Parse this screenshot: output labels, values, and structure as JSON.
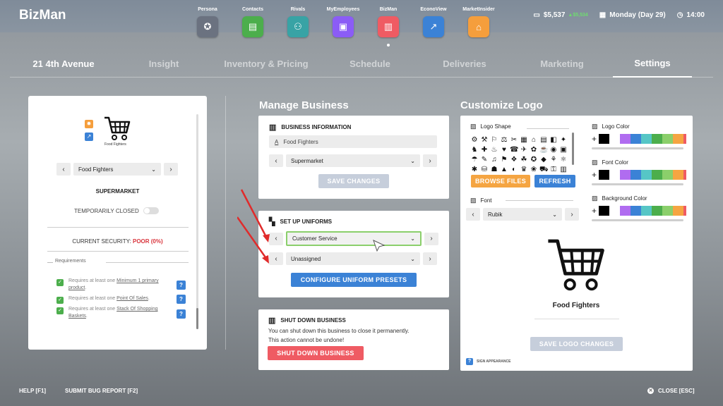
{
  "brand": "BizMan",
  "apps": [
    {
      "label": "Persona",
      "icon": "star-badge-icon",
      "color": "#6b7280",
      "glyph": "✪"
    },
    {
      "label": "Contacts",
      "icon": "chat-icon",
      "color": "#4cae4c",
      "glyph": "▤"
    },
    {
      "label": "Rivals",
      "icon": "group-icon",
      "color": "#38a3a5",
      "glyph": "⚇"
    },
    {
      "label": "MyEmployees",
      "icon": "id-badge-icon",
      "color": "#8b5cf6",
      "glyph": "▣"
    },
    {
      "label": "BizMan",
      "icon": "store-icon",
      "color": "#ef5b63",
      "glyph": "▥"
    },
    {
      "label": "EconoView",
      "icon": "trend-icon",
      "color": "#3b82d6",
      "glyph": "↗"
    },
    {
      "label": "MarketInsider",
      "icon": "house-chart-icon",
      "color": "#f59e3c",
      "glyph": "⌂"
    }
  ],
  "status": {
    "money": "$5,537",
    "gain": "▲$5,534",
    "day": "Monday (Day 29)",
    "time": "14:00"
  },
  "tabs": [
    "21 4th Avenue",
    "Insight",
    "Inventory & Pricing",
    "Schedule",
    "Deliveries",
    "Marketing",
    "Settings"
  ],
  "left": {
    "logo_name": "Food Fighters",
    "selected_business": "Food Fighters",
    "business_type": "SUPERMARKET",
    "temporarily_closed": "TEMPORARILY CLOSED",
    "security_label": "CURRENT SECURITY:",
    "security_value": "POOR (0%)",
    "requirements_title": "Requirements",
    "requirements": [
      {
        "prefix": "Requires at least one ",
        "link": "Minimum 1 primary product",
        "suffix": "."
      },
      {
        "prefix": "Requires at least one ",
        "link": "Point Of Sales",
        "suffix": "."
      },
      {
        "prefix": "Requires at least one ",
        "link": "Stack Of Shopping Baskets",
        "suffix": "."
      }
    ]
  },
  "manage": {
    "title": "Manage Business",
    "info_title": "BUSINESS INFORMATION",
    "name_value": "Food Fighters",
    "type_value": "Supermarket",
    "save_label": "SAVE CHANGES",
    "uniforms_title": "SET UP UNIFORMS",
    "uniform_1": "Customer Service",
    "uniform_2": "Unassigned",
    "configure_label": "CONFIGURE UNIFORM PRESETS",
    "shutdown_title": "SHUT DOWN BUSINESS",
    "shutdown_text_1": "You can shut down this business to close it permanently.",
    "shutdown_text_2": "This action cannot be undone!",
    "shutdown_label": "SHUT DOWN BUSINESS"
  },
  "logo": {
    "title": "Customize Logo",
    "shape_label": "Logo Shape",
    "logo_color_label": "Logo Color",
    "font_color_label": "Font Color",
    "bg_color_label": "Background Color",
    "browse_label": "BROWSE FILES",
    "refresh_label": "REFRESH",
    "font_label": "Font",
    "font_value": "Rubik",
    "preview_name": "Food Fighters",
    "save_label": "SAVE LOGO CHANGES",
    "sign_label": "SIGN APPEARANCE",
    "palette": [
      "#000000",
      "#ffffff",
      "#b06cf0",
      "#3b82d6",
      "#56c6c6",
      "#4cae4c",
      "#8bcf6b",
      "#f5a542",
      "#ef5b63"
    ],
    "glyphs": [
      "⚙",
      "⚒",
      "⚐",
      "⚖",
      "✂",
      "▦",
      "⌂",
      "▤",
      "◧",
      "✦",
      "♞",
      "✚",
      "♨",
      "♥",
      "☎",
      "✈",
      "✿",
      "☕",
      "◉",
      "▣",
      "☂",
      "✎",
      "♫",
      "⚑",
      "❖",
      "☘",
      "✪",
      "◆",
      "⚘",
      "⚛",
      "✱",
      "⛁",
      "☗",
      "▲",
      "◐",
      "♛",
      "❀",
      "⛟",
      "⚿",
      "▥"
    ]
  },
  "footer": {
    "help": "HELP [F1]",
    "bug": "SUBMIT BUG REPORT [F2]",
    "close": "CLOSE [ESC]"
  }
}
